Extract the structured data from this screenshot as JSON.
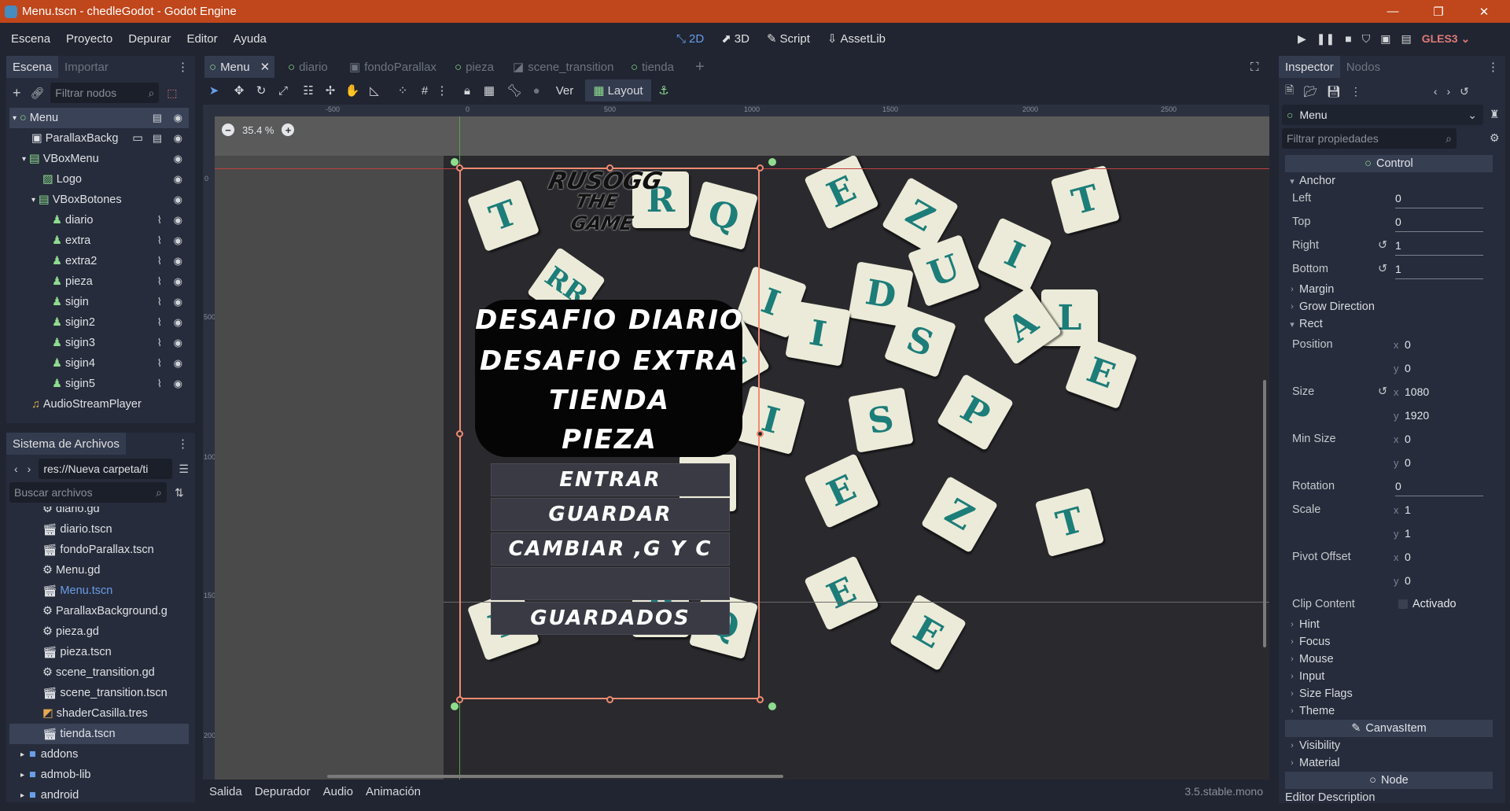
{
  "window": {
    "title": "Menu.tscn - chedleGodot - Godot Engine"
  },
  "menubar": {
    "items": [
      "Escena",
      "Proyecto",
      "Depurar",
      "Editor",
      "Ayuda"
    ],
    "workspaces": {
      "w2d": "2D",
      "w3d": "3D",
      "script": "Script",
      "assetlib": "AssetLib"
    },
    "renderer": "GLES3"
  },
  "scene_dock": {
    "tab_active": "Escena",
    "tab_inactive": "Importar",
    "filter_placeholder": "Filtrar nodos",
    "nodes": [
      "Menu",
      "ParallaxBackg",
      "VBoxMenu",
      "Logo",
      "VBoxBotones",
      "diario",
      "extra",
      "extra2",
      "pieza",
      "sigin",
      "sigin2",
      "sigin3",
      "sigin4",
      "sigin5",
      "AudioStreamPlayer"
    ]
  },
  "filesystem": {
    "title": "Sistema de Archivos",
    "path": "res://Nueva carpeta/ti",
    "search_placeholder": "Buscar archivos",
    "files": [
      "diario.gd",
      "diario.tscn",
      "fondoParallax.tscn",
      "Menu.gd",
      "Menu.tscn",
      "ParallaxBackground.g",
      "pieza.gd",
      "pieza.tscn",
      "scene_transition.gd",
      "scene_transition.tscn",
      "shaderCasilla.tres",
      "tienda.tscn"
    ],
    "folders": [
      "addons",
      "admob-lib",
      "android"
    ]
  },
  "editor": {
    "tabs": [
      "Menu",
      "diario",
      "fondoParallax",
      "pieza",
      "scene_transition",
      "tienda"
    ],
    "zoom": "35.4 %",
    "toolbar": {
      "ver": "Ver",
      "layout": "Layout"
    },
    "ruler_h": [
      "-500",
      "0",
      "500",
      "1000",
      "1500",
      "2000",
      "2500"
    ],
    "ruler_v": [
      "0",
      "500",
      "1000",
      "1500",
      "2000"
    ]
  },
  "game": {
    "logo_line1": "RUSOGG",
    "logo_line2": "THE GAME",
    "menu_labels": [
      "DESAFIO DIARIO",
      "DESAFIO EXTRA",
      "TIENDA",
      "PIEZA"
    ],
    "buttons": [
      "ENTRAR",
      "GUARDAR",
      "CAMBIAR ,G Y C",
      "",
      "GUARDADOS"
    ],
    "tiles": [
      "T",
      "R",
      "Q",
      "E",
      "Z",
      "T",
      "I",
      "D",
      "U",
      "I",
      "L",
      "RR",
      "E",
      "I",
      "S",
      "A",
      "I",
      "S",
      "P",
      "C",
      "E",
      "L",
      "E",
      "Z",
      "T",
      "Y",
      "R",
      "Q",
      "E",
      "E"
    ]
  },
  "bottom": {
    "tabs": [
      "Salida",
      "Depurador",
      "Audio",
      "Animación"
    ],
    "version": "3.5.stable.mono"
  },
  "inspector": {
    "tab_active": "Inspector",
    "tab_inactive": "Nodos",
    "node": "Menu",
    "filter_placeholder": "Filtrar propiedades",
    "category": "Control",
    "anchor": "Anchor",
    "left_lbl": "Left",
    "left": "0",
    "top_lbl": "Top",
    "top": "0",
    "right_lbl": "Right",
    "right": "1",
    "bottom_lbl": "Bottom",
    "bottom": "1",
    "margin": "Margin",
    "grow": "Grow Direction",
    "rect": "Rect",
    "position_lbl": "Position",
    "pos_x": "0",
    "pos_y": "0",
    "size_lbl": "Size",
    "size_x": "1080",
    "size_y": "1920",
    "minsize_lbl": "Min Size",
    "min_x": "0",
    "min_y": "0",
    "rotation_lbl": "Rotation",
    "rotation": "0",
    "scale_lbl": "Scale",
    "scale_x": "1",
    "scale_y": "1",
    "pivot_lbl": "Pivot Offset",
    "pivot_x": "0",
    "pivot_y": "0",
    "clip_lbl": "Clip Content",
    "clip_val": "Activado",
    "sections": [
      "Hint",
      "Focus",
      "Mouse",
      "Input",
      "Size Flags",
      "Theme"
    ],
    "canvasitem": "CanvasItem",
    "sections2": [
      "Visibility",
      "Material"
    ],
    "node_cat": "Node",
    "editor_desc": "Editor Description"
  }
}
